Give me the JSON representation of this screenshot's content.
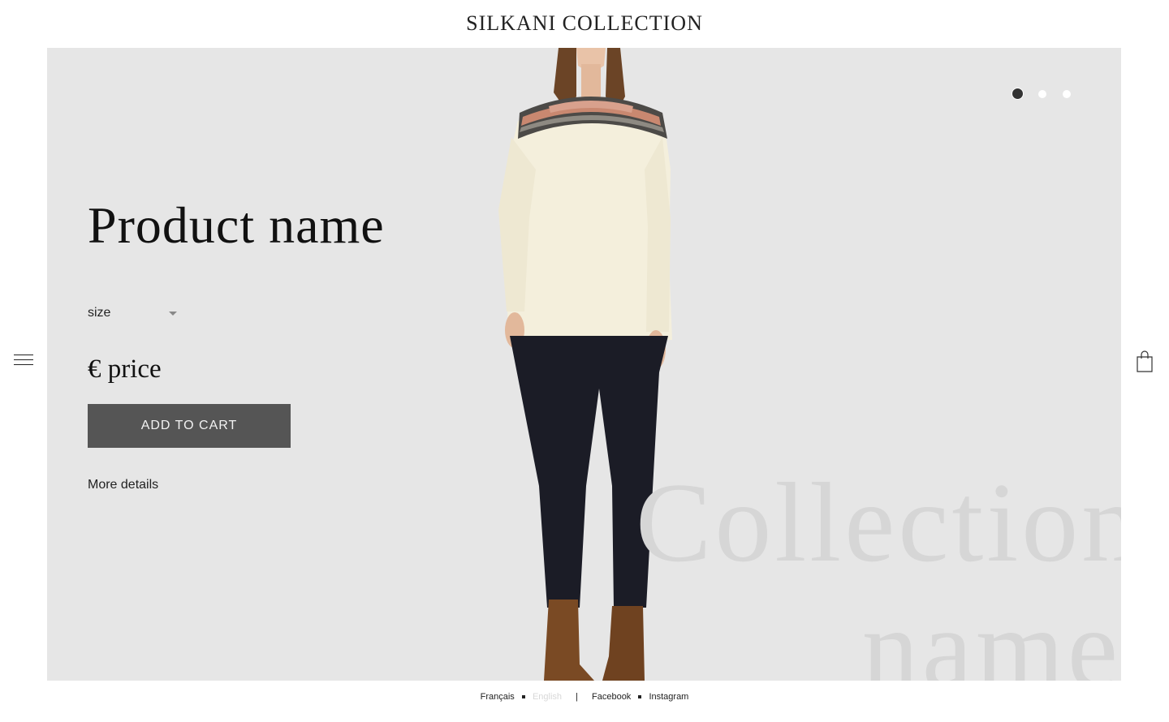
{
  "header": {
    "brand": "SILKANI COLLECTION"
  },
  "carousel": {
    "slides": 3,
    "active_index": 0
  },
  "product": {
    "title": "Product name",
    "size_label": "size",
    "price": "€ price",
    "add_to_cart": "ADD TO CART",
    "more_details": "More details"
  },
  "hero": {
    "watermark_line1": "Collection",
    "watermark_line2": "name",
    "background": "#e6e6e6"
  },
  "footer": {
    "lang_fr": "Français",
    "lang_en": "English",
    "separator": "|",
    "facebook": "Facebook",
    "instagram": "Instagram"
  },
  "icons": {
    "menu": "hamburger-menu-icon",
    "cart": "shopping-bag-icon"
  },
  "colors": {
    "button": "#555555",
    "active_dot": "#333333"
  }
}
